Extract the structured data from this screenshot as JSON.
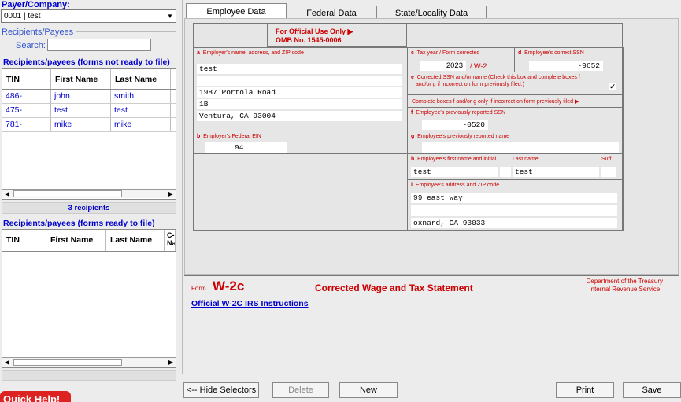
{
  "left": {
    "payer_label": "Payer/Company:",
    "payer_value": "0001 | test",
    "recipients_group_title": "Recipients/Payees",
    "search_label": "Search:",
    "search_value": "",
    "not_ready_title": "Recipients/payees (forms not ready to file)",
    "not_ready_columns": [
      "TIN",
      "First Name",
      "Last Name"
    ],
    "not_ready_rows": [
      {
        "tin": "486-",
        "first": "john",
        "last": "smith"
      },
      {
        "tin": "475-",
        "first": "test",
        "last": "test"
      },
      {
        "tin": "781-",
        "first": "mike",
        "last": "mike"
      }
    ],
    "recipient_count": "3 recipients",
    "ready_title": "Recipients/payees (forms ready to file)",
    "ready_columns": [
      "TIN",
      "First Name",
      "Last Name",
      "C­Na"
    ],
    "quick_help": "Quick Help!"
  },
  "tabs": [
    "Employee Data",
    "Federal Data",
    "State/Locality Data"
  ],
  "form": {
    "official_line1": "For Official Use Only ▶",
    "official_line2": "OMB No. 1545-0006",
    "a_letter": "a",
    "a_label": "Employer's name, address, and ZIP code",
    "a_lines": [
      "test",
      "",
      "1987 Portola Road",
      "1B",
      "Ventura, CA 93004"
    ],
    "c_letter": "c",
    "c_label": "Tax year / Form corrected",
    "c_year": "2023",
    "c_form": "/ W-2",
    "d_letter": "d",
    "d_label": "Employee's correct SSN",
    "d_value": "-9652",
    "e_letter": "e",
    "e_label_1": "Corrected SSN and/or name (Check this box and complete boxes f",
    "e_label_2": "and/or g if incorrect on form previously filed.)",
    "e_checked": "✔",
    "complete_note": "Complete boxes f and/or g only if incorrect on form previously filed  ▶",
    "b_letter": "b",
    "b_label": "Employer's Federal EIN",
    "b_value": "94",
    "f_letter": "f",
    "f_label": "Employee's previously reported SSN",
    "f_value": "-0520",
    "g_letter": "g",
    "g_label": "Employee's previously reported name",
    "h_letter": "h",
    "h_label": "Employee's first name and initial",
    "h_last_label": "Last name",
    "h_suff_label": "Suff.",
    "h_first": "test",
    "h_last": "test",
    "i_letter": "i",
    "i_label": "Employee's address and ZIP code",
    "i_lines": [
      "99 east way",
      "",
      "oxnard, CA 93033"
    ]
  },
  "footer": {
    "form_word": "Form",
    "form_code": "W-2c",
    "title": "Corrected Wage and Tax Statement",
    "dept_line1": "Department of the Treasury",
    "dept_line2": "Internal Revenue Service",
    "instructions_link": "Official W-2C  IRS Instructions"
  },
  "buttons": {
    "hide": "<-- Hide Selectors",
    "delete": "Delete",
    "new": "New",
    "print": "Print",
    "save": "Save"
  },
  "colors": {
    "label_red": "#cc0000",
    "link_blue": "#0000cc",
    "quick_help_red": "#dd2222"
  }
}
